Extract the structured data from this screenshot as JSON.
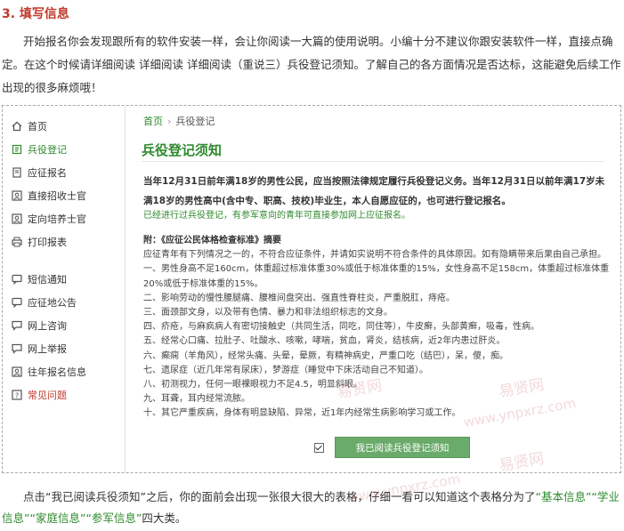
{
  "section_heading": "3. 填写信息",
  "intro_paragraph": "开始报名你会发现跟所有的软件安装一样，会让你阅读一大篇的使用说明。小编十分不建议你跟安装软件一样，直接点确定。在这个时候请详细阅读 详细阅读 详细阅读（重说三）兵役登记须知。了解自己的各方面情况是否达标，这能避免后续工作出现的很多麻烦哦！",
  "sidebar": {
    "items": [
      {
        "label": "首页",
        "icon": "home-icon"
      },
      {
        "label": "兵役登记",
        "icon": "register-icon"
      },
      {
        "label": "应征报名",
        "icon": "document-icon"
      },
      {
        "label": "直接招收士官",
        "icon": "person-card-icon"
      },
      {
        "label": "定向培养士官",
        "icon": "person-card-icon"
      },
      {
        "label": "打印报表",
        "icon": "printer-icon"
      },
      {
        "label": "短信通知",
        "icon": "message-icon"
      },
      {
        "label": "应征地公告",
        "icon": "message-icon"
      },
      {
        "label": "网上咨询",
        "icon": "chat-icon"
      },
      {
        "label": "网上举报",
        "icon": "chat-icon"
      },
      {
        "label": "往年报名信息",
        "icon": "person-card-icon"
      },
      {
        "label": "常见问题",
        "icon": "question-icon"
      }
    ]
  },
  "breadcrumb": {
    "home": "首页",
    "separator": "›",
    "current": "兵役登记"
  },
  "page_title": "兵役登记须知",
  "lead_text": "当年12月31日前年满18岁的男性公民，应当按照法律规定履行兵役登记义务。当年12月31日以前年满17岁未满18岁的男性高中(含中专、职高、技校)毕业生，本人自愿应征的，也可进行登记报名。",
  "lead_note": "已经进行过兵役登记，有参军意向的青年可直接参加网上应征报名。",
  "annex": {
    "title": "附：《应征公民体格检查标准》摘要",
    "lines": [
      "应征青年有下列情况之一的，不符合应征条件，并请如实说明不符合条件的具体原因。如有隐瞒带来后果由自己承担。",
      "一、男性身高不足160cm，体重超过标准体重30%或低于标准体重的15%，女性身高不足158cm，体重超过标准体重20%或低于标准体重的15%。",
      "二、影响劳动的慢性腰腿痛、腰椎间盘突出、强直性脊柱炎，严重脱肛，痔疮。",
      "三、面颈部文身，以及带有色情、暴力和非法组织标志的文身。",
      "四、疥疮，与麻疯病人有密切接触史（共同生活，同吃，同住等），牛皮癣，头部黄癣，吸毒，性病。",
      "五、经常心口痛、拉肚子、吐酸水、咳嗽，哮喘，贫血，肾炎，结核病，近2年内患过肝炎。",
      "六、癫痫（羊角风），经常头痛、头晕，晕厥，有精神病史，严重口吃（结巴），呆，傻，痴。",
      "七、遗尿症（近几年常有尿床），梦游症（睡觉中下床活动自己不知道）。",
      "八、初测视力，任何一眼裸眼视力不足4.5，明显斜眼。",
      "九、耳聋，耳内经常流脓。",
      "十、其它严重疾病，身体有明显缺陷、异常，近1年内经常生病影响学习或工作。"
    ]
  },
  "agree_button": "我已阅读兵役登记须知",
  "outro": {
    "part1": "点击“我已阅读兵役须知”之后，你的面前会出现一张很大很大的表格，仔细一看可以知道这个表格分为了",
    "cats": [
      "“基本信息”",
      "“学业信息”",
      "“家庭信息”",
      "“参军信息”"
    ],
    "part2": "四大类。"
  },
  "watermarks": [
    "易贤网",
    "www.ynpxrz.com",
    "易贤网",
    "www.ynpxrz.com",
    "易贤网"
  ]
}
